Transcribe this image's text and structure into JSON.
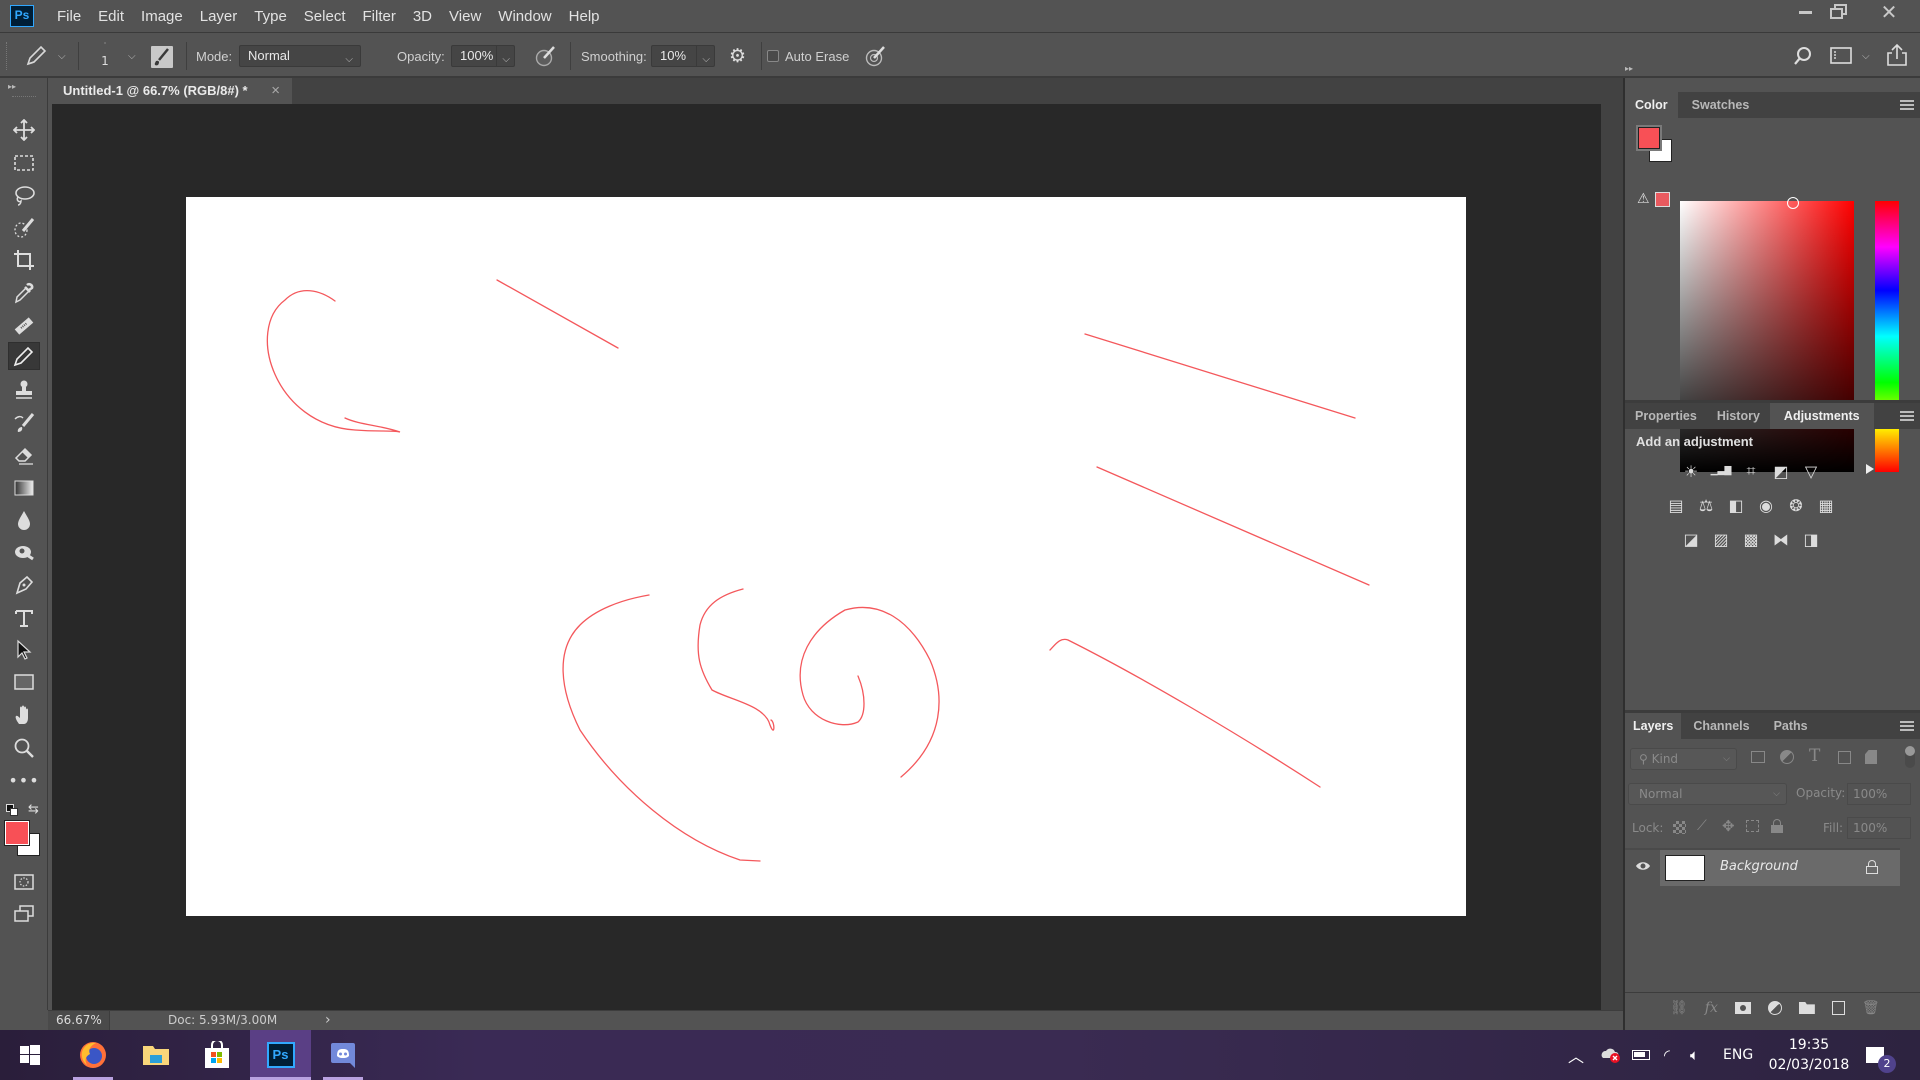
{
  "app": {
    "logo": "Ps",
    "menu": [
      "File",
      "Edit",
      "Image",
      "Layer",
      "Type",
      "Select",
      "Filter",
      "3D",
      "View",
      "Window",
      "Help"
    ],
    "window_controls": [
      "minimize",
      "restore",
      "close"
    ]
  },
  "options_bar": {
    "tool_icon": "pencil-icon",
    "brush_size": "1",
    "mode_label": "Mode:",
    "mode_value": "Normal",
    "opacity_label": "Opacity:",
    "opacity_value": "100%",
    "smoothing_label": "Smoothing:",
    "smoothing_value": "10%",
    "auto_erase_label": "Auto Erase",
    "auto_erase_checked": false
  },
  "document": {
    "tab_title": "Untitled-1 @ 66.7% (RGB/8#) *",
    "close_glyph": "×",
    "stroke_color": "#f4585c",
    "strokes": [
      "M335 301 C320 290 300 285 285 300 C245 330 275 425 355 430 C380 432 390 430 400 432 C380 425 360 425 345 418",
      "M497 280 L618 348",
      "M1085 334 L1355 418",
      "M1097 467 L1369 585",
      "M1050 650 C1055 645 1060 637 1068 640 C1140 676 1240 735 1320 787",
      "M649 595 C620 600 595 610 580 625 C555 650 560 690 580 730 C620 790 680 840 740 860 L760 861",
      "M743 589 C720 595 705 605 700 625 C695 655 700 670 712 690 C730 700 765 705 770 725 C775 738 775 722 771 720",
      "M858 676 C866 695 866 715 858 722 C840 730 810 720 803 695 C793 660 810 630 845 610 C880 600 910 620 930 660 C945 695 945 740 901 777"
    ]
  },
  "status": {
    "zoom": "66.67%",
    "doc_info": "Doc: 5.93M/3.00M",
    "arrow": "›"
  },
  "colors": {
    "foreground": "#f85056",
    "background": "#ffffff",
    "gamut_swatch": "#e95a5f"
  },
  "color_panel": {
    "tabs": [
      "Color",
      "Swatches"
    ],
    "active_tab": "Color"
  },
  "adjustments_panel": {
    "tabs": [
      "Properties",
      "History",
      "Adjustments"
    ],
    "active_tab": "Adjustments",
    "heading": "Add an adjustment",
    "rows": [
      [
        "brightness-contrast-icon",
        "levels-icon",
        "curves-icon",
        "exposure-icon",
        "vibrance-icon"
      ],
      [
        "hue-saturation-icon",
        "color-balance-icon",
        "black-white-icon",
        "photo-filter-icon",
        "channel-mixer-icon",
        "color-lookup-icon"
      ],
      [
        "invert-icon",
        "posterize-icon",
        "threshold-icon",
        "selective-color-icon",
        "gradient-map-icon"
      ]
    ]
  },
  "layers_panel": {
    "tabs": [
      "Layers",
      "Channels",
      "Paths"
    ],
    "active_tab": "Layers",
    "filter_placeholder": "Kind",
    "blend_mode": "Normal",
    "opacity_label": "Opacity:",
    "opacity_value": "100%",
    "lock_label": "Lock:",
    "fill_label": "Fill:",
    "fill_value": "100%",
    "layers": [
      {
        "name": "Background",
        "visible": true,
        "locked": true
      }
    ]
  },
  "taskbar": {
    "apps": [
      "windows-start",
      "firefox",
      "file-explorer",
      "microsoft-store",
      "photoshop",
      "discord"
    ],
    "active_app": "photoshop",
    "language": "ENG",
    "time": "19:35",
    "date": "02/03/2018",
    "notification_count": "2"
  }
}
